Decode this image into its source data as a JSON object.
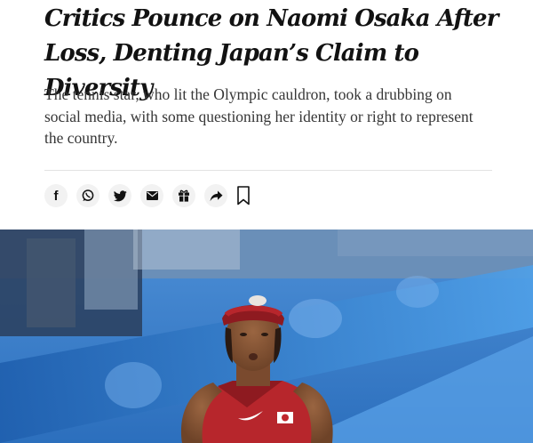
{
  "article": {
    "headline": "Critics Pounce on Naomi Osaka After Loss, Denting Japan’s Claim to Diversity",
    "summary": "The tennis star, who lit the Olympic cauldron, took a drubbing on social media, with some questioning her identity or right to represent the country."
  },
  "share_bar": {
    "icons": [
      "facebook-icon",
      "whatsapp-icon",
      "twitter-icon",
      "email-icon",
      "gift-icon",
      "share-icon",
      "bookmark-icon"
    ],
    "facebook_glyph": "f"
  },
  "colors": {
    "headline": "#121212",
    "summary": "#363636",
    "icon": "#121212",
    "icon_bg": "#f2f2f2",
    "divider": "#e2e2e2",
    "court_blue": "#3a7cc9",
    "kit_red": "#b7262c"
  }
}
